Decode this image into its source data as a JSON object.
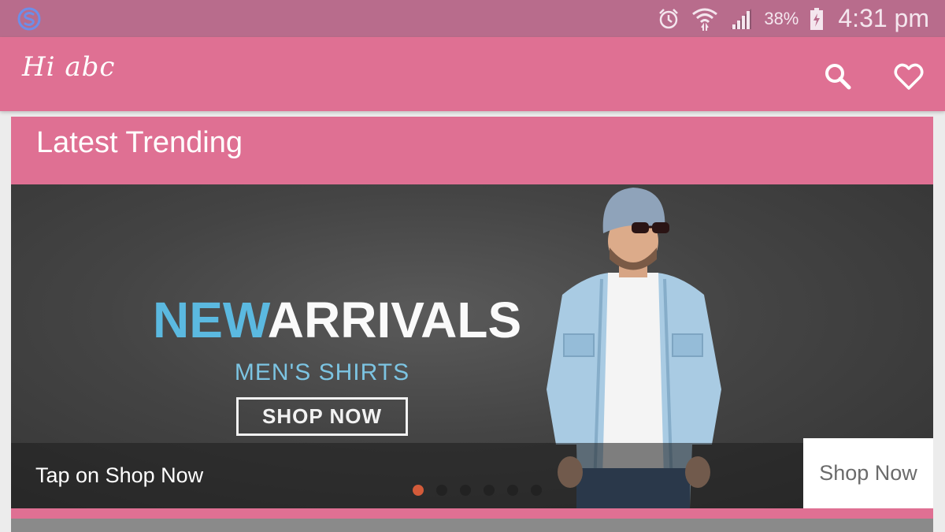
{
  "status_bar": {
    "battery_percent": "38%",
    "time": "4:31 pm",
    "icons": [
      "app-s-icon",
      "alarm-icon",
      "wifi-icon",
      "signal-icon",
      "battery-charging-icon"
    ]
  },
  "app_bar": {
    "greeting": "Hi abc",
    "actions": [
      "search-icon",
      "heart-icon"
    ]
  },
  "card": {
    "title": "Latest Trending",
    "banner": {
      "headline_part1": "NEW",
      "headline_part2": "ARRIVALS",
      "subline": "MEN'S SHIRTS",
      "promo_button": "SHOP NOW"
    },
    "caption": "Tap on Shop Now",
    "shop_now_label": "Shop Now",
    "carousel": {
      "total": 6,
      "active_index": 0
    }
  },
  "colors": {
    "status_bar": "#b86c8c",
    "primary": "#df7093",
    "accent_blue": "#5bb9e0",
    "active_dot": "#d35b3a"
  }
}
